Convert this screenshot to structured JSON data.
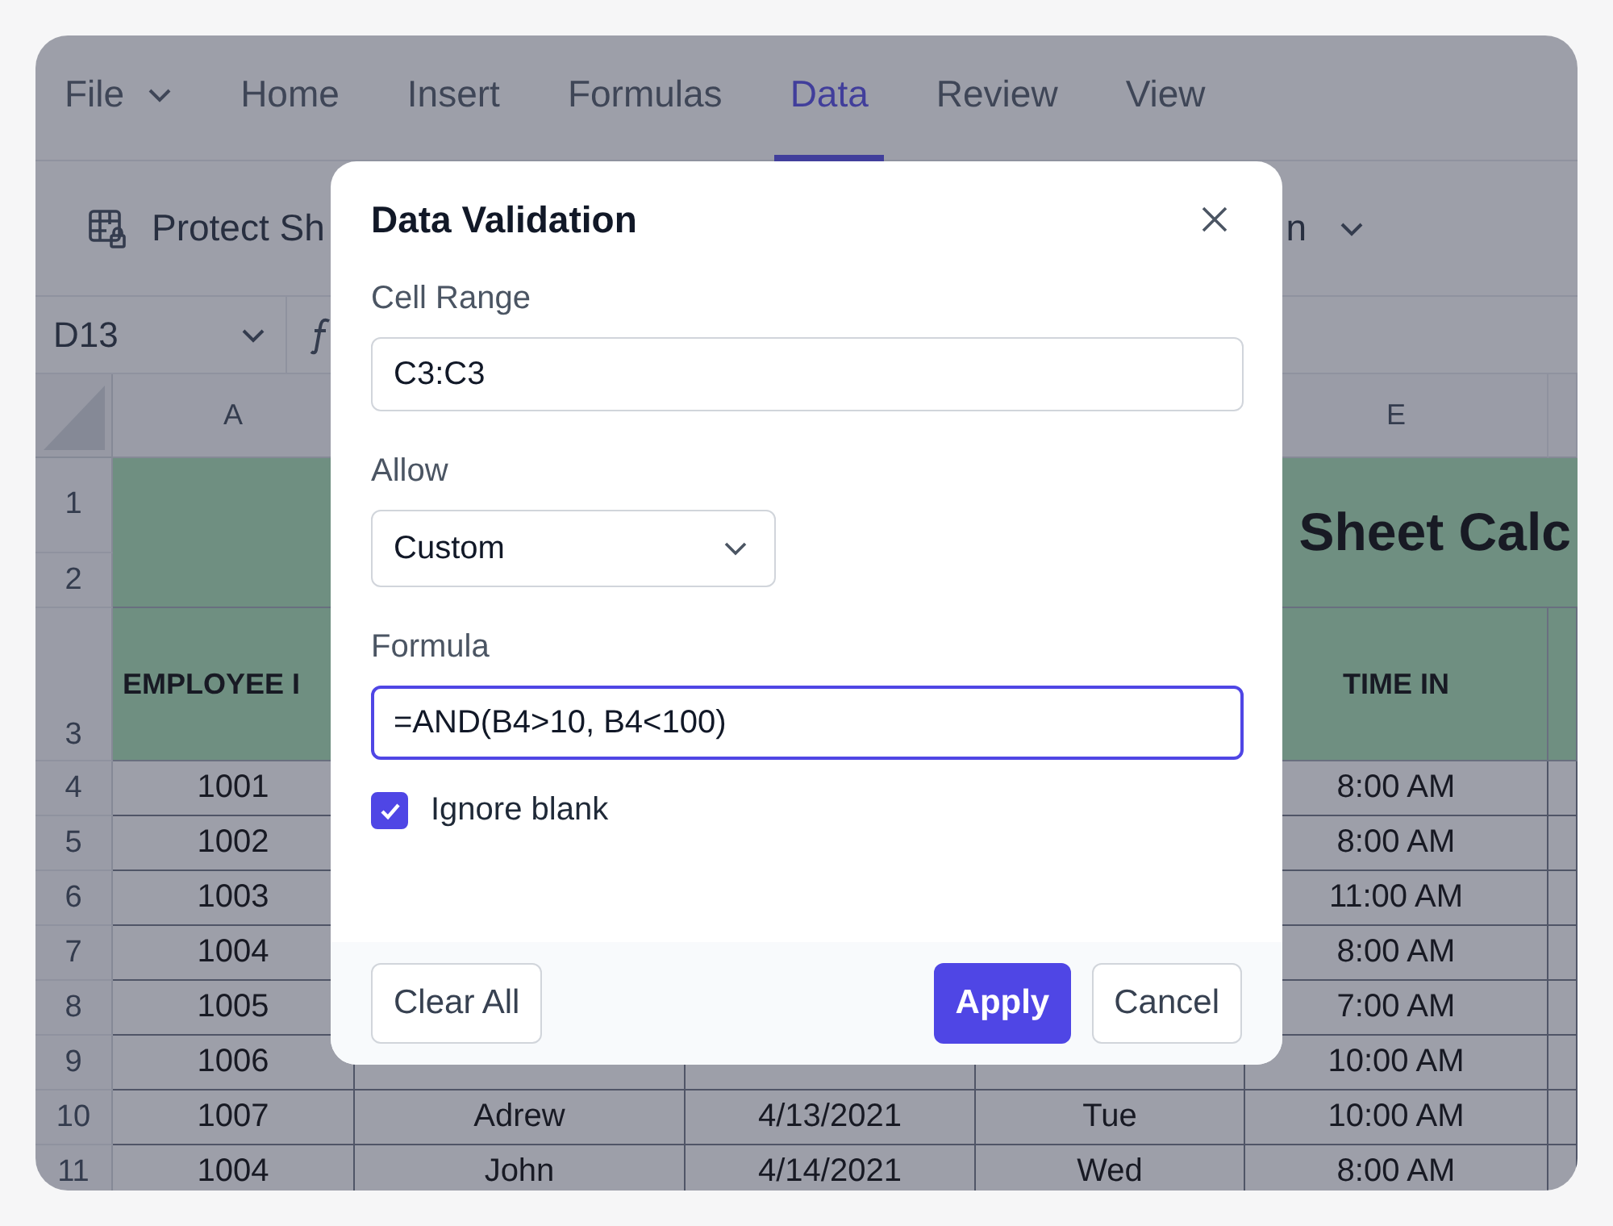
{
  "menu_tabs": [
    {
      "label": "File",
      "has_menu": true,
      "selected": false
    },
    {
      "label": "Home",
      "has_menu": false,
      "selected": false
    },
    {
      "label": "Insert",
      "has_menu": false,
      "selected": false
    },
    {
      "label": "Formulas",
      "has_menu": false,
      "selected": false
    },
    {
      "label": "Data",
      "has_menu": false,
      "selected": true
    },
    {
      "label": "Review",
      "has_menu": false,
      "selected": false
    },
    {
      "label": "View",
      "has_menu": false,
      "selected": false
    }
  ],
  "toolbar": {
    "protect_label": "Protect Sh",
    "trailing_label": "n"
  },
  "formula_bar": {
    "name_box": "D13"
  },
  "sheet": {
    "column_headers": {
      "A": "A",
      "E": "E"
    },
    "title": "Sheet Calc",
    "header_cells": {
      "A": "EMPLOYEE I",
      "E": "TIME IN"
    },
    "header_row_numbers": [
      "1",
      "2",
      "3"
    ],
    "rows": [
      {
        "number": "4",
        "cells": {
          "A": "1001",
          "E": "8:00 AM"
        }
      },
      {
        "number": "5",
        "cells": {
          "A": "1002",
          "E": "8:00 AM"
        }
      },
      {
        "number": "6",
        "cells": {
          "A": "1003",
          "E": "11:00 AM"
        }
      },
      {
        "number": "7",
        "cells": {
          "A": "1004",
          "E": "8:00 AM"
        }
      },
      {
        "number": "8",
        "cells": {
          "A": "1005",
          "E": "7:00 AM"
        }
      },
      {
        "number": "9",
        "cells": {
          "A": "1006",
          "E": "10:00 AM"
        }
      },
      {
        "number": "10",
        "cells": {
          "A": "1007",
          "B": "Adrew",
          "C": "4/13/2021",
          "D": "Tue",
          "E": "10:00 AM"
        }
      },
      {
        "number": "11",
        "cells": {
          "A": "1004",
          "B": "John",
          "C": "4/14/2021",
          "D": "Wed",
          "E": "8:00 AM"
        }
      }
    ]
  },
  "dialog": {
    "title": "Data Validation",
    "cell_range": {
      "label": "Cell Range",
      "value": "C3:C3"
    },
    "allow": {
      "label": "Allow",
      "value": "Custom"
    },
    "formula": {
      "label": "Formula",
      "value": "=AND(B4>10, B4<100)",
      "focused": true
    },
    "ignore_blank": {
      "label": "Ignore blank",
      "checked": true
    },
    "buttons": [
      {
        "label": "Clear All",
        "kind": "secondary"
      },
      {
        "label": "Apply",
        "kind": "primary"
      },
      {
        "label": "Cancel",
        "kind": "secondary"
      }
    ]
  }
}
